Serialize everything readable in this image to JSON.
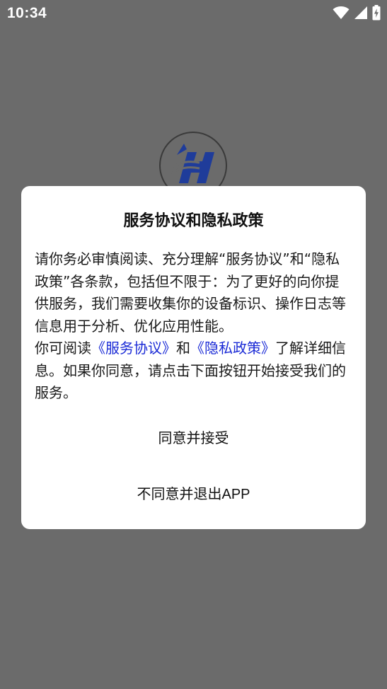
{
  "status_bar": {
    "time": "10:34",
    "icons": [
      "wifi-icon",
      "cellular-signal-icon",
      "battery-charging-icon"
    ]
  },
  "dialog": {
    "title": "服务协议和隐私政策",
    "body_para1": "请你务必审慎阅读、充分理解“服务协议”和“隐私政策”各条款，包括但不限于：为了更好的向你提供服务，我们需要收集你的设备标识、操作日志等信息用于分析、优化应用性能。",
    "body_para2_prefix": "你可阅读",
    "link_service": "《服务协议》",
    "body_para2_and": "和",
    "link_privacy": "《隐私政策》",
    "body_para2_suffix": "了解详细信息。如果你同意，请点击下面按钮开始接受我们的服务。",
    "accept_label": "同意并接受",
    "decline_label": "不同意并退出APP"
  },
  "colors": {
    "overlay": "#6b6b6b",
    "link": "#1b2bd6",
    "logo_blue": "#1f3c9a"
  }
}
